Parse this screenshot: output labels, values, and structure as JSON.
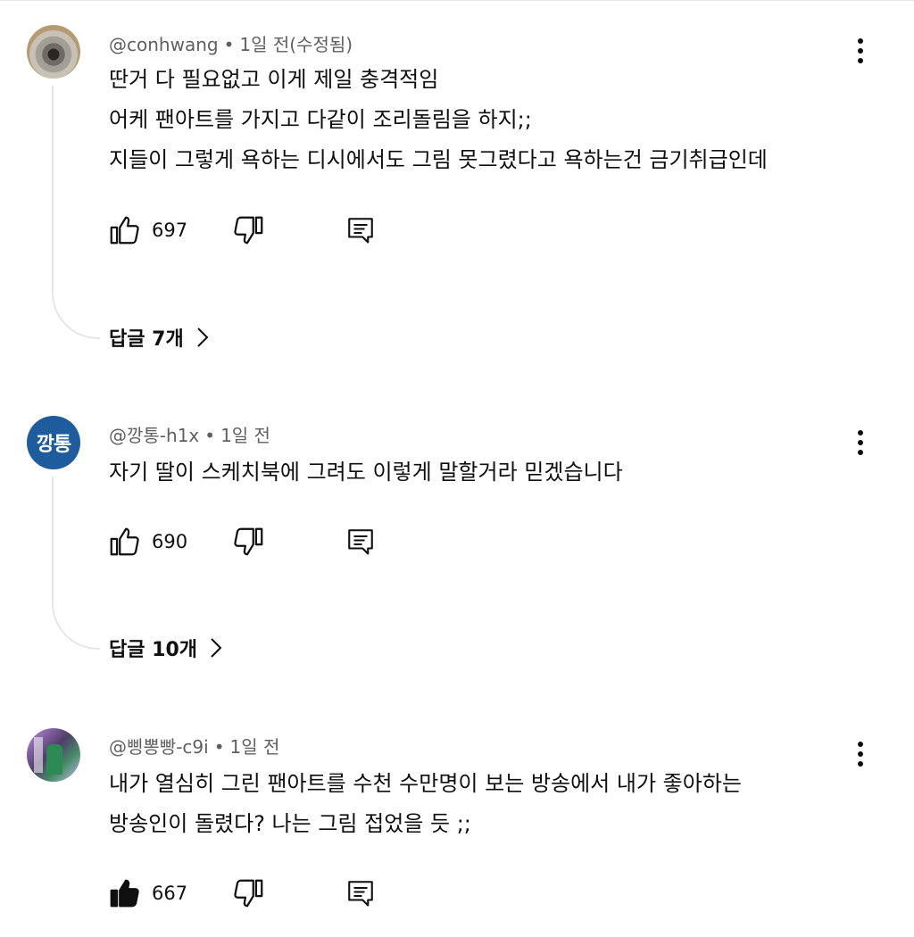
{
  "colors": {
    "text": "#0f0f0f",
    "meta": "#606060",
    "thread_line": "#e6e6e6",
    "avatar_text_bg": "#1f5c9e"
  },
  "comments": [
    {
      "author": "@conhwang",
      "time": "1일 전(수정됨)",
      "avatar_type": "photo",
      "lines": [
        "딴거 다 필요없고 이게 제일 충격적임",
        "어케 팬아트를 가지고 다같이 조리돌림을 하지;;",
        "지들이 그렇게 욕하는 디시에서도 그림 못그렸다고 욕하는건 금기취급인데"
      ],
      "likes": "697",
      "liked": false,
      "replies_label": "답글 7개"
    },
    {
      "author": "@깡통-h1x",
      "time": "1일 전",
      "avatar_type": "text",
      "avatar_text": "깡통",
      "lines": [
        "자기 딸이 스케치북에 그려도 이렇게 말할거라 믿겠습니다"
      ],
      "likes": "690",
      "liked": false,
      "replies_label": "답글 10개"
    },
    {
      "author": "@삥뽕빵-c9i",
      "time": "1일 전",
      "avatar_type": "photo",
      "lines": [
        "내가 열심히 그린 팬아트를 수천 수만명이 보는 방송에서 내가 좋아하는",
        "방송인이 돌렸다? 나는 그림 접었을 듯 ;;"
      ],
      "likes": "667",
      "liked": true
    }
  ],
  "icons": {
    "like": "thumbs-up-icon",
    "dislike": "thumbs-down-icon",
    "reply": "comment-reply-icon",
    "more": "more-vert-icon",
    "chevron": "chevron-right-icon"
  }
}
